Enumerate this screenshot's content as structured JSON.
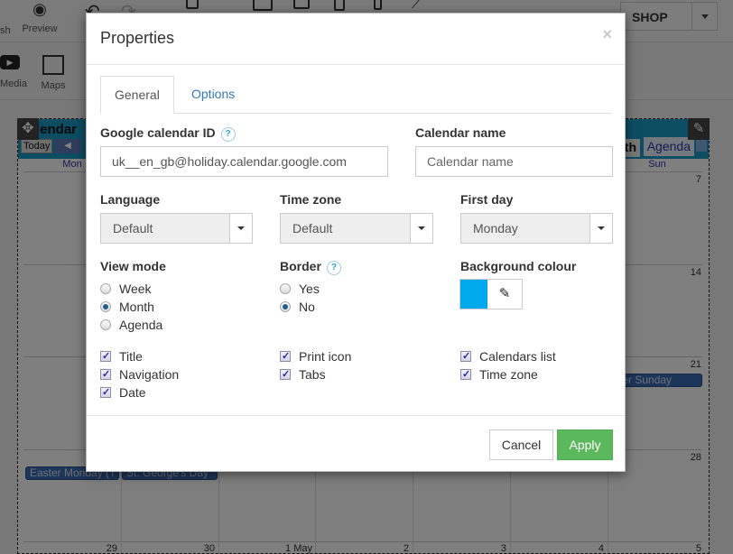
{
  "background_app": {
    "toolbar": {
      "publish_label": "sh",
      "preview_label": "Preview",
      "shop_select": "SHOP"
    },
    "widgets": {
      "media_label": "Media",
      "maps_label": "Maps"
    },
    "calendar": {
      "title_fragment": "lendar",
      "today_label": "Today",
      "tab_month_fragment": "th",
      "tab_agenda": "Agenda",
      "day_headers": [
        "Mon",
        "Sun"
      ],
      "sunday_numbers": [
        "7",
        "14",
        "21",
        "28"
      ],
      "bottom_row_numbers": [
        "29",
        "30",
        "1 May",
        "2",
        "3",
        "4",
        "5"
      ],
      "events": [
        {
          "label": "Easter Monday (T"
        },
        {
          "label": "St. George's Day"
        },
        {
          "label": "ster Sunday"
        }
      ]
    }
  },
  "modal": {
    "title": "Properties",
    "close_label": "×",
    "tabs": [
      {
        "label": "General",
        "active": true
      },
      {
        "label": "Options",
        "active": false
      }
    ],
    "fields": {
      "google_calendar_id": {
        "label": "Google calendar ID",
        "value": "uk__en_gb@holiday.calendar.google.com",
        "help": "?"
      },
      "calendar_name": {
        "label": "Calendar name",
        "value": "",
        "placeholder": "Calendar name"
      },
      "language": {
        "label": "Language",
        "selected": "Default"
      },
      "time_zone": {
        "label": "Time zone",
        "selected": "Default"
      },
      "first_day": {
        "label": "First day",
        "selected": "Monday"
      },
      "view_mode": {
        "label": "View mode",
        "options": [
          {
            "label": "Week",
            "checked": false
          },
          {
            "label": "Month",
            "checked": true
          },
          {
            "label": "Agenda",
            "checked": false
          }
        ]
      },
      "border": {
        "label": "Border",
        "help": "?",
        "options": [
          {
            "label": "Yes",
            "checked": false
          },
          {
            "label": "No",
            "checked": true
          }
        ]
      },
      "background_colour": {
        "label": "Background colour",
        "value": "#00a8ec"
      }
    },
    "checkboxes": [
      {
        "label": "Title",
        "checked": true
      },
      {
        "label": "Navigation",
        "checked": true
      },
      {
        "label": "Date",
        "checked": true
      },
      {
        "label": "Print icon",
        "checked": true
      },
      {
        "label": "Tabs",
        "checked": true
      },
      {
        "label": "Calendars list",
        "checked": true
      },
      {
        "label": "Time zone",
        "checked": true
      }
    ],
    "footer": {
      "cancel_label": "Cancel",
      "apply_label": "Apply"
    }
  },
  "colors": {
    "apply_green": "#5cb85c",
    "link_blue": "#337ab7",
    "swatch": "#00a8ec"
  }
}
